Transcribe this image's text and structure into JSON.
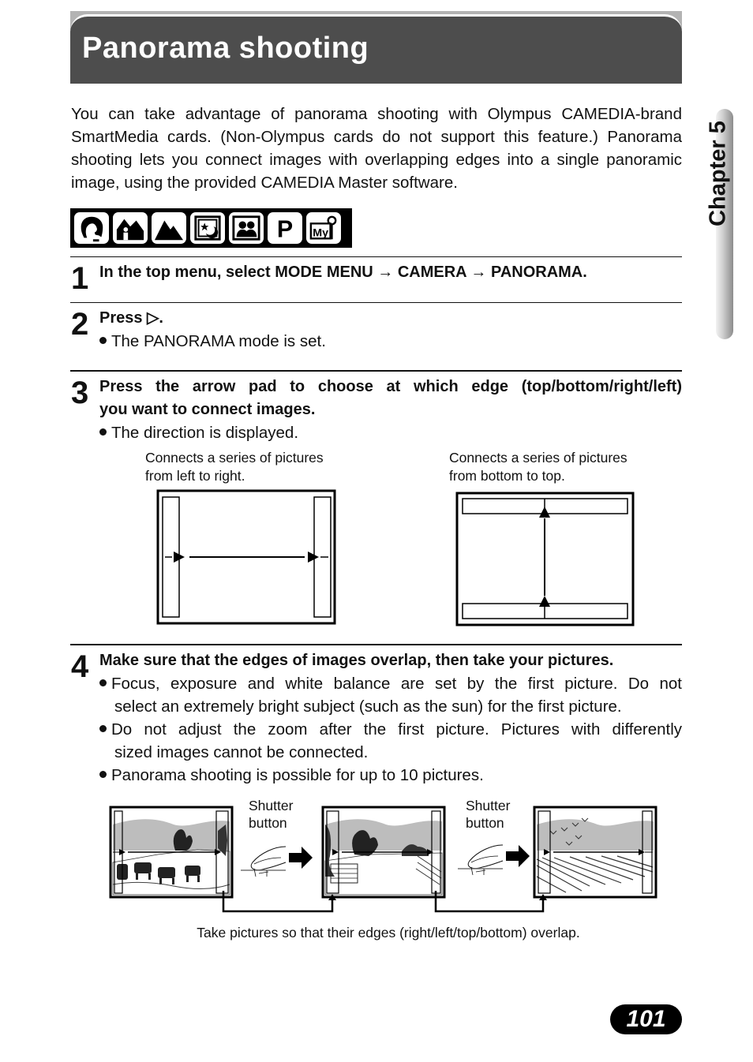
{
  "header": {
    "title": "Panorama shooting"
  },
  "chapter_tab": {
    "label": "Chapter 5"
  },
  "intro": "You can take advantage of panorama shooting with Olympus CAMEDIA-brand SmartMedia cards. (Non-Olympus cards do not support this feature.) Panorama shooting lets you connect images with overlapping edges into a single panoramic image, using the provided CAMEDIA Master software.",
  "mode_icons": [
    "portrait-mode-icon",
    "landscape-portrait-mode-icon",
    "landscape-mode-icon",
    "night-scene-mode-icon",
    "self-portrait-mode-icon",
    "program-mode-icon",
    "my-mode-icon"
  ],
  "mode_labels": {
    "program": "P",
    "my": "My"
  },
  "steps": [
    {
      "number": "1",
      "instruction": "In the top menu, select MODE MENU → CAMERA → PANORAMA.",
      "bullets": []
    },
    {
      "number": "2",
      "instruction": "Press ▷.",
      "bullets": [
        "The PANORAMA mode is set."
      ]
    },
    {
      "number": "3",
      "instruction_line1": "Press the arrow pad to choose at which edge (top/bottom/right/left)",
      "instruction_line2": "you want to connect images.",
      "bullets": [
        "The direction is displayed."
      ]
    },
    {
      "number": "4",
      "instruction": "Make sure that the edges of images overlap, then take your pictures.",
      "bullets": [
        {
          "line1": "Focus, exposure and white balance are set by the first picture. Do not",
          "line2": "select an extremely bright subject (such as the sun) for the first picture."
        },
        {
          "line1": "Do not adjust the zoom after the first picture. Pictures with differently",
          "line2": "sized images cannot be connected."
        },
        {
          "line1": "Panorama shooting is possible for up to 10 pictures."
        }
      ]
    }
  ],
  "diagrams": {
    "left_to_right": {
      "caption_line1": "Connects a series of pictures",
      "caption_line2": "from left to right."
    },
    "bottom_to_top": {
      "caption_line1": "Connects a series of pictures",
      "caption_line2": "from bottom to top."
    }
  },
  "sequence": {
    "shutter_label_line1": "Shutter",
    "shutter_label_line2": "button",
    "caption": "Take pictures so that their edges (right/left/top/bottom) overlap."
  },
  "page_number": "101",
  "colors": {
    "title_bar": "#4d4d4d",
    "top_band": "#b3b3b3",
    "ink": "#111111",
    "sky_gray": "#bdbdbd"
  }
}
